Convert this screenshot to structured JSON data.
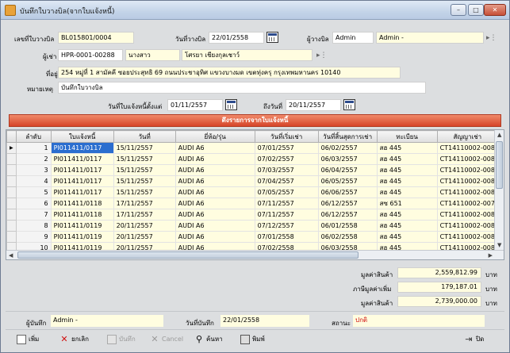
{
  "window": {
    "title": "บันทึกใบวางบิล(จากใบแจ้งหนี้)",
    "minimize": "–",
    "maximize": "□",
    "close": "✕"
  },
  "form": {
    "bill_no_label": "เลขที่ใบวางบิล",
    "bill_no": "BL015801/0004",
    "bill_date_label": "วันที่วางบิล",
    "bill_date": "22/01/2558",
    "issuer_label": "ผู้วางบิล",
    "issuer_code": "Admin",
    "issuer_name": "Admin -",
    "tenant_label": "ผู้เช่า",
    "tenant_code": "HPR-0001-00288",
    "tenant_title": "นางสาว",
    "tenant_name": "โศรยา เชียงกุลเชาว์",
    "address_label": "ที่อยู่",
    "address": "254 หมู่ที่ 1 สามัคคี ซอยประสุทธิ 69 ถนนประชาอุทิศ แขวงบางมด เขตทุ่งครุ กรุงเทพมหานคร 10140",
    "note_label": "หมายเหตุ",
    "note": "บันทึกใบวางบิล",
    "from_label": "วันที่ใบแจ้งหนี้ตั้งแต่",
    "from_date": "01/11/2557",
    "to_label": "ถึงวันที่",
    "to_date": "20/11/2557"
  },
  "fetch_button": "ดึงรายการจากใบแจ้งหนี้",
  "table": {
    "headers": [
      "ลำดับ",
      "ใบแจ้งหนี้",
      "วันที่",
      "ยี่ห้อ/รุ่น",
      "วันที่เริ่มเช่า",
      "วันที่สิ้นสุดการเช่า",
      "ทะเบียน",
      "สัญญาเช่า"
    ],
    "rows": [
      [
        "1",
        "PI011411/0117",
        "15/11/2557",
        "AUDI A6",
        "07/01/2557",
        "06/02/2557",
        "สฮ 445",
        "CT14110002-008"
      ],
      [
        "2",
        "PI011411/0117",
        "15/11/2557",
        "AUDI A6",
        "07/02/2557",
        "06/03/2557",
        "สฮ 445",
        "CT14110002-008"
      ],
      [
        "3",
        "PI011411/0117",
        "15/11/2557",
        "AUDI A6",
        "07/03/2557",
        "06/04/2557",
        "สฮ 445",
        "CT14110002-008"
      ],
      [
        "4",
        "PI011411/0117",
        "15/11/2557",
        "AUDI A6",
        "07/04/2557",
        "06/05/2557",
        "สฮ 445",
        "CT14110002-008"
      ],
      [
        "5",
        "PI011411/0117",
        "15/11/2557",
        "AUDI A6",
        "07/05/2557",
        "06/06/2557",
        "สฮ 445",
        "CT14110002-008"
      ],
      [
        "6",
        "PI011411/0118",
        "17/11/2557",
        "AUDI A6",
        "07/11/2557",
        "06/12/2557",
        "สซ 651",
        "CT14110002-007"
      ],
      [
        "7",
        "PI011411/0118",
        "17/11/2557",
        "AUDI A6",
        "07/11/2557",
        "06/12/2557",
        "สฮ 445",
        "CT14110002-008"
      ],
      [
        "8",
        "PI011411/0119",
        "20/11/2557",
        "AUDI A6",
        "07/12/2557",
        "06/01/2558",
        "สฮ 445",
        "CT14110002-008"
      ],
      [
        "9",
        "PI011411/0119",
        "20/11/2557",
        "AUDI A6",
        "07/01/2558",
        "06/02/2558",
        "สฮ 445",
        "CT14110002-008"
      ],
      [
        "10",
        "PI011411/0119",
        "20/11/2557",
        "AUDI A6",
        "07/02/2558",
        "06/03/2558",
        "สฮ 445",
        "CT14110002-008"
      ]
    ]
  },
  "totals": {
    "subtotal_label": "มูลค่าสินค้า",
    "subtotal": "2,559,812.99",
    "vat_label": "ภาษีมูลค่าเพิ่ม",
    "vat": "179,187.01",
    "total_label": "มูลค่าสินค้า",
    "total": "2,739,000.00",
    "unit": "บาท"
  },
  "footer": {
    "recorder_label": "ผู้บันทึก",
    "recorder": "Admin -",
    "record_date_label": "วันที่บันทึก",
    "record_date": "22/01/2558",
    "status_label": "สถานะ",
    "status": "ปกติ"
  },
  "toolbar": {
    "add": "เพิ่ม",
    "cancel_doc": "ยกเลิก",
    "save": "บันทึก",
    "cancel": "Cancel",
    "search": "ค้นหา",
    "print": "พิมพ์",
    "exit": "ปิด"
  },
  "colors": {
    "selected": "#2b6ecf",
    "status": "#d01010",
    "fetch_bar": "#d6452a"
  }
}
